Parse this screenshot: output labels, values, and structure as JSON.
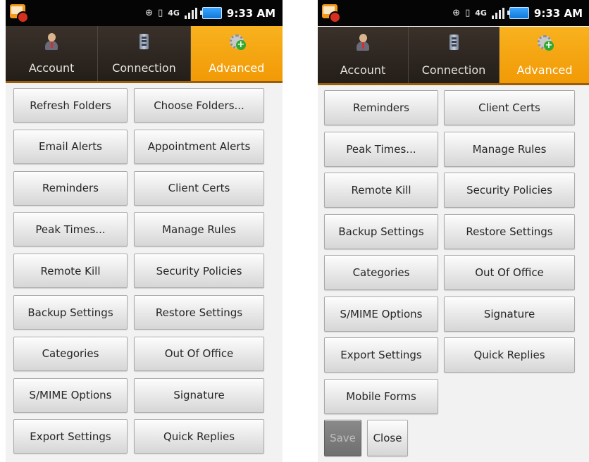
{
  "status_bar": {
    "time": "9:33 AM",
    "network_label": "4G"
  },
  "tabs": [
    {
      "label": "Account",
      "icon": "person-icon",
      "active": false
    },
    {
      "label": "Connection",
      "icon": "connection-icon",
      "active": false
    },
    {
      "label": "Advanced",
      "icon": "gear-add-icon",
      "active": true
    }
  ],
  "colors": {
    "active_tab": "#f5a512",
    "tab_bar": "#2d2620",
    "background": "#f2f2f2"
  },
  "left_screen": {
    "buttons": [
      [
        "Refresh Folders",
        "Choose Folders..."
      ],
      [
        "Email Alerts",
        "Appointment Alerts"
      ],
      [
        "Reminders",
        "Client Certs"
      ],
      [
        "Peak Times...",
        "Manage Rules"
      ],
      [
        "Remote Kill",
        "Security Policies"
      ],
      [
        "Backup Settings",
        "Restore Settings"
      ],
      [
        "Categories",
        "Out Of Office"
      ],
      [
        "S/MIME Options",
        "Signature"
      ],
      [
        "Export Settings",
        "Quick Replies"
      ]
    ]
  },
  "right_screen": {
    "buttons": [
      [
        "Reminders",
        "Client Certs"
      ],
      [
        "Peak Times...",
        "Manage Rules"
      ],
      [
        "Remote Kill",
        "Security Policies"
      ],
      [
        "Backup Settings",
        "Restore Settings"
      ],
      [
        "Categories",
        "Out Of Office"
      ],
      [
        "S/MIME Options",
        "Signature"
      ],
      [
        "Export Settings",
        "Quick Replies"
      ],
      [
        "Mobile Forms"
      ]
    ],
    "footer": {
      "save_label": "Save",
      "close_label": "Close"
    }
  }
}
